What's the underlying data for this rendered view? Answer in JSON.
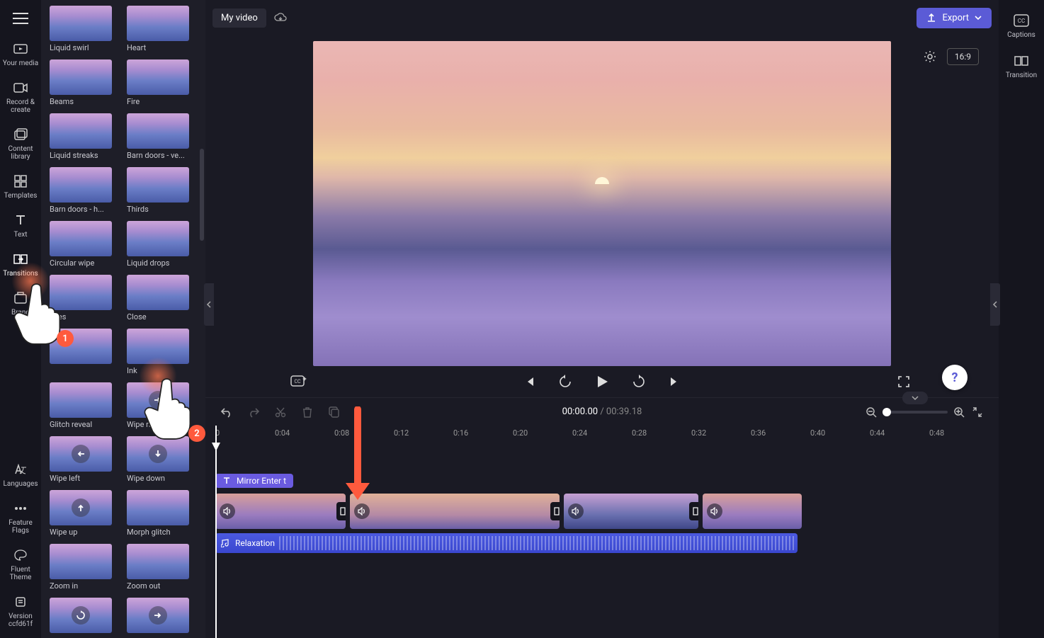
{
  "project": {
    "name": "My video"
  },
  "export_label": "Export",
  "aspect_ratio": "16:9",
  "left_rail": [
    {
      "id": "your-media",
      "label": "Your media"
    },
    {
      "id": "record-create",
      "label": "Record & create"
    },
    {
      "id": "content-library",
      "label": "Content library"
    },
    {
      "id": "templates",
      "label": "Templates"
    },
    {
      "id": "text",
      "label": "Text"
    },
    {
      "id": "transitions",
      "label": "Transitions",
      "active": true
    },
    {
      "id": "brand",
      "label": "Brand"
    }
  ],
  "left_rail_bottom": [
    {
      "id": "languages",
      "label": "Languages"
    },
    {
      "id": "feature-flags",
      "label": "Feature Flags"
    },
    {
      "id": "fluent-theme",
      "label": "Fluent Theme"
    },
    {
      "id": "version",
      "label": "Version ccfd61f"
    }
  ],
  "right_rail": [
    {
      "id": "captions",
      "label": "Captions"
    },
    {
      "id": "transition",
      "label": "Transition"
    }
  ],
  "transitions": [
    {
      "label": "Liquid swirl"
    },
    {
      "label": "Heart"
    },
    {
      "label": "Beams"
    },
    {
      "label": "Fire"
    },
    {
      "label": "Liquid streaks"
    },
    {
      "label": "Barn doors - ve..."
    },
    {
      "label": "Barn doors - h..."
    },
    {
      "label": "Thirds"
    },
    {
      "label": "Circular wipe"
    },
    {
      "label": "Liquid drops"
    },
    {
      "label": "Tiles"
    },
    {
      "label": "Close"
    },
    {
      "label": ""
    },
    {
      "label": "Ink"
    },
    {
      "label": "Glitch reveal"
    },
    {
      "label": "Wipe right",
      "arrow": "right"
    },
    {
      "label": "Wipe left",
      "arrow": "left"
    },
    {
      "label": "Wipe down",
      "arrow": "down"
    },
    {
      "label": "Wipe up",
      "arrow": "up"
    },
    {
      "label": "Morph glitch"
    },
    {
      "label": "Zoom in"
    },
    {
      "label": "Zoom out"
    },
    {
      "label": "",
      "arrow": "reload"
    },
    {
      "label": "",
      "arrow": "right"
    }
  ],
  "playback": {
    "current": "00:00.00",
    "duration": "00:39.18"
  },
  "ruler_ticks": [
    "0",
    "0:04",
    "0:08",
    "0:12",
    "0:16",
    "0:20",
    "0:24",
    "0:28",
    "0:32",
    "0:36",
    "0:40",
    "0:44",
    "0:48"
  ],
  "title_clip": {
    "label": "Mirror Enter t"
  },
  "audio_clip": {
    "label": "Relaxation"
  },
  "help_label": "?",
  "tutorial_badges": {
    "one": "1",
    "two": "2"
  }
}
